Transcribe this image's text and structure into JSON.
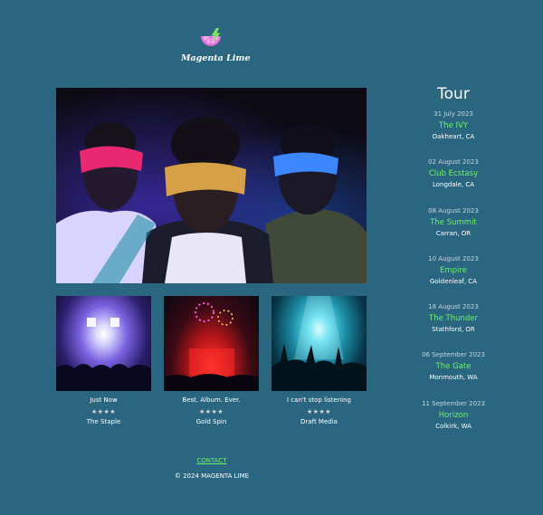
{
  "brand": {
    "name": "Magenta Lime",
    "logo_icon": "lime-slice-lightning-icon"
  },
  "hero": {
    "image": "blindfolded-trio-photo"
  },
  "albums": [
    {
      "title": "Just Now",
      "rating": 4,
      "stars": "★★★★",
      "label": "The Staple",
      "image": "concert-stage-lights-photo"
    },
    {
      "title": "Best. Album. Ever.",
      "rating": 4,
      "stars": "★★★★",
      "label": "Gold Spin",
      "image": "fireworks-stage-photo"
    },
    {
      "title": "I can't stop listening",
      "rating": 4,
      "stars": "★★★★",
      "label": "Draft Media",
      "image": "crowd-spotlight-photo"
    }
  ],
  "tour": {
    "heading": "Tour",
    "dates": [
      {
        "date": "31 July 2023",
        "venue": "The IVY",
        "city": "Oakheart, CA"
      },
      {
        "date": "02 August 2023",
        "venue": "Club Ecstasy",
        "city": "Longdale, CA"
      },
      {
        "date": "08 August 2023",
        "venue": "The Summit",
        "city": "Carran, OR"
      },
      {
        "date": "10 August 2023",
        "venue": "Empire",
        "city": "Goldenleaf, CA"
      },
      {
        "date": "18 August 2023",
        "venue": "The Thunder",
        "city": "Stathford, OR"
      },
      {
        "date": "06 September 2023",
        "venue": "The Gate",
        "city": "Monmouth, WA"
      },
      {
        "date": "11 September 2023",
        "venue": "Horizon",
        "city": "Colkirk, WA"
      }
    ]
  },
  "footer": {
    "contact_label": "CONTACT",
    "copyright": "© 2024 MAGENTA LIME"
  },
  "colors": {
    "background": "#2b6680",
    "accent_green": "#6cf06a",
    "logo_pink": "#e070d8"
  }
}
